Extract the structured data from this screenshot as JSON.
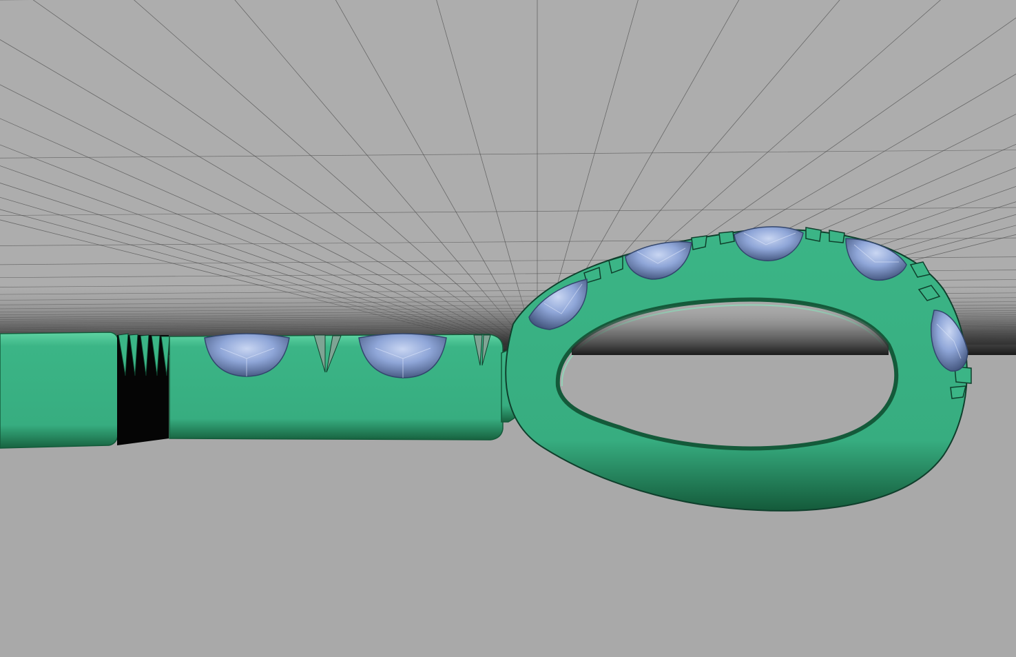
{
  "viewport": {
    "name": "3d-viewport",
    "background_color": "#ababab",
    "floor_color": "#a9a9a9",
    "grid_line_color": "#4a4a4a",
    "horizon_color": "#1e1e1e"
  },
  "model": {
    "name": "ring-shank-with-loop",
    "metal_color": "#3bb586",
    "metal_shadow_color": "#1f7a55",
    "metal_dark_color": "#0f3f2c",
    "stone_color": "#8fa6d8",
    "stone_dark_color": "#4c5f8a",
    "stone_count_shank": 2,
    "stone_count_loop": 5
  }
}
